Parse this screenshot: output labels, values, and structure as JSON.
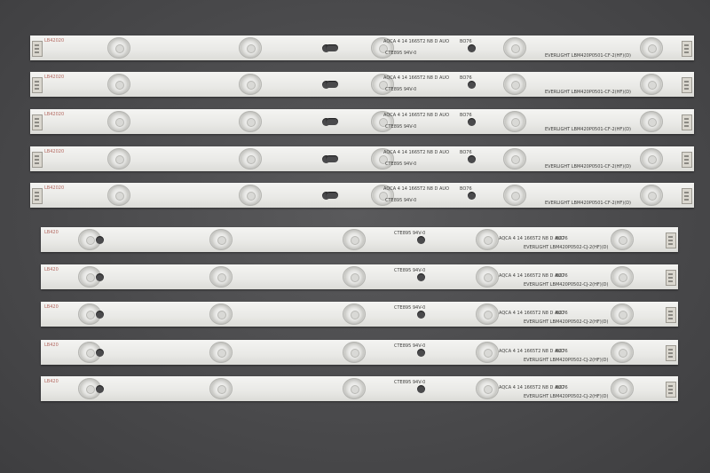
{
  "strips_top": [
    {
      "model": "AQCA 4 14 1665T2 N8 D AUO",
      "code": "BO76",
      "brand": "EVERLIGHT  LBM420P0501-CF-2(HF)(D)",
      "cert": "CTE895  94V-0",
      "label": "LB42020"
    },
    {
      "model": "AQCA 4 14 1665T2 N8 D AUO",
      "code": "BO76",
      "brand": "EVERLIGHT  LBM420P0501-CF-2(HF)(D)",
      "cert": "CTE895  94V-0",
      "label": "LB42020"
    },
    {
      "model": "AQCA 4 14 1665T2 N8 D AUO",
      "code": "BO76",
      "brand": "EVERLIGHT  LBM420P0501-CF-2(HF)(D)",
      "cert": "CTE895  94V-0",
      "label": "LB42020"
    },
    {
      "model": "AQCA 4 14 1665T2 N8 D AUO",
      "code": "BO76",
      "brand": "EVERLIGHT  LBM420P0501-CF-2(HF)(D)",
      "cert": "CTE895  94V-0",
      "label": "LB42020"
    },
    {
      "model": "AQCA 4 14 1665T2 N8 D AUO",
      "code": "BO76",
      "brand": "EVERLIGHT  LBM420P0501-CF-2(HF)(D)",
      "cert": "CTE895  94V-0",
      "label": "LB42020"
    }
  ],
  "strips_bottom": [
    {
      "model": "AQCA 4 14 1665T2 N8 D AUO",
      "code": "BO76",
      "brand": "EVERLIGHT  LBM420P0502-CJ-2(HF)(D)",
      "cert": "CTE895  94V-0",
      "label": "LB420"
    },
    {
      "model": "AQCA 4 14 1665T2 N8 D AUO",
      "code": "BO76",
      "brand": "EVERLIGHT  LBM420P0502-CJ-2(HF)(D)",
      "cert": "CTE895  94V-0",
      "label": "LB420"
    },
    {
      "model": "AQCA 4 14 1665T2 N8 D AUO",
      "code": "BO76",
      "brand": "EVERLIGHT  LBM420P0502-CJ-2(HF)(D)",
      "cert": "CTE895  94V-0",
      "label": "LB420"
    },
    {
      "model": "AQCA 4 14 1665T2 N8 D AUO",
      "code": "BO76",
      "brand": "EVERLIGHT  LBM420P0502-CJ-2(HF)(D)",
      "cert": "CTE895  94V-0",
      "label": "LB420"
    },
    {
      "model": "AQCA 4 14 1665T2 N8 D AUO",
      "code": "BO76",
      "brand": "EVERLIGHT  LBM420P0502-CJ-2(HF)(D)",
      "cert": "CTE895  94V-0",
      "label": "LB420"
    }
  ],
  "colors": {
    "background": "#4a4a4c",
    "strip": "#ececea",
    "lens": "#e4e4e2"
  }
}
